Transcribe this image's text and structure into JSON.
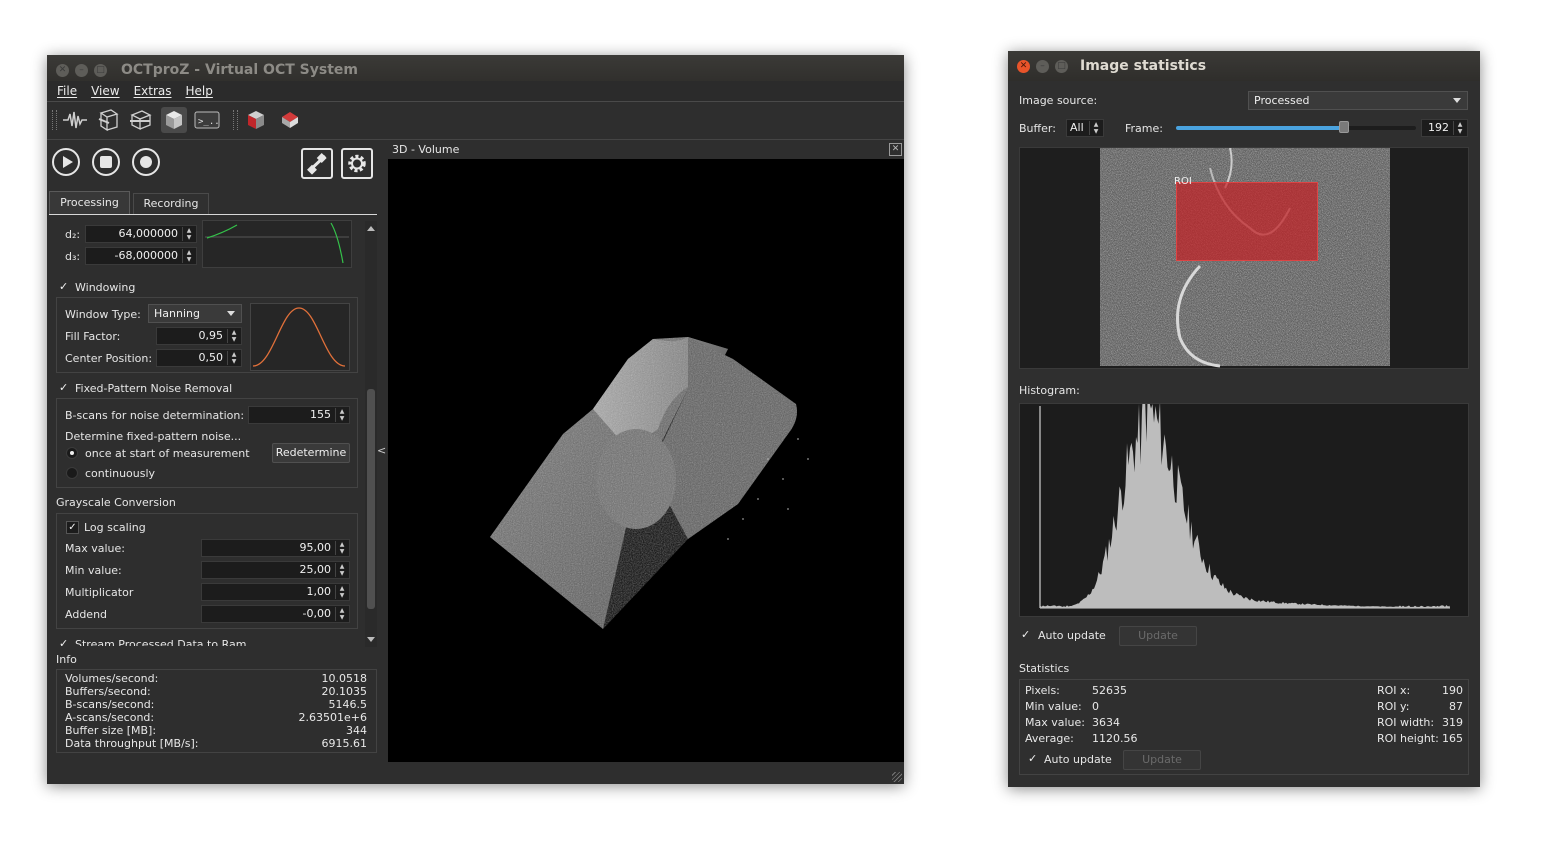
{
  "main_window": {
    "title": "OCTproZ - Virtual OCT System",
    "menu": [
      "File",
      "View",
      "Extras",
      "Help"
    ],
    "toolbar_icons": [
      "signal-plot-icon",
      "bscan-icon",
      "enface-icon",
      "volume-icon",
      "console-icon",
      "extension-icon",
      "extension-red-icon"
    ],
    "control_icons": [
      "play-icon",
      "stop-icon",
      "record-icon",
      "system-connect-icon",
      "settings-gear-icon"
    ],
    "tabs": [
      "Processing",
      "Recording"
    ],
    "dispersion": {
      "d2_label": "d₂:",
      "d2_value": "64,000000",
      "d3_label": "d₃:",
      "d3_value": "-68,000000"
    },
    "windowing": {
      "title": "Windowing",
      "window_type_label": "Window Type:",
      "window_type_value": "Hanning",
      "fill_factor_label": "Fill Factor:",
      "fill_factor_value": "0,95",
      "center_position_label": "Center Position:",
      "center_position_value": "0,50"
    },
    "fixed_pattern": {
      "title": "Fixed-Pattern Noise Removal",
      "bscans_label": "B-scans for noise determination:",
      "bscans_value": "155",
      "determine_label": "Determine fixed-pattern noise...",
      "option_once": "once at start of measurement",
      "option_continuous": "continuously",
      "redetermine_button": "Redetermine"
    },
    "grayscale": {
      "title": "Grayscale Conversion",
      "log_scaling_label": "Log scaling",
      "max_label": "Max value:",
      "max_value": "95,00",
      "min_label": "Min value:",
      "min_value": "25,00",
      "mult_label": "Multiplicator",
      "mult_value": "1,00",
      "addend_label": "Addend",
      "addend_value": "-0,00"
    },
    "stream_label": "Stream Processed Data to Ram",
    "info": {
      "title": "Info",
      "rows": [
        {
          "label": "Volumes/second:",
          "value": "10.0518"
        },
        {
          "label": "Buffers/second:",
          "value": "20.1035"
        },
        {
          "label": "B-scans/second:",
          "value": "5146.5"
        },
        {
          "label": "A-scans/second:",
          "value": "2.63501e+6"
        },
        {
          "label": "Buffer size [MB]:",
          "value": "344"
        },
        {
          "label": "Data throughput [MB/s]:",
          "value": "6915.61"
        }
      ]
    },
    "volume_view_title": "3D - Volume",
    "collapse_handle": "<"
  },
  "stats_window": {
    "title": "Image statistics",
    "image_source_label": "Image source:",
    "image_source_value": "Processed",
    "buffer_label": "Buffer:",
    "buffer_value": "All",
    "frame_label": "Frame:",
    "frame_value": "192",
    "frame_slider_fraction": 0.7,
    "roi_label": "ROI",
    "histogram_label": "Histogram:",
    "auto_update_label": "Auto update",
    "update_button": "Update",
    "statistics_title": "Statistics",
    "stats_left": [
      {
        "label": "Pixels:",
        "value": "52635"
      },
      {
        "label": "Min value:",
        "value": "0"
      },
      {
        "label": "Max value:",
        "value": "3634"
      },
      {
        "label": "Average:",
        "value": "1120.56"
      }
    ],
    "stats_right": [
      {
        "label": "ROI x:",
        "value": "190"
      },
      {
        "label": "ROI y:",
        "value": "87"
      },
      {
        "label": "ROI width:",
        "value": "319"
      },
      {
        "label": "ROI height:",
        "value": "165"
      }
    ]
  },
  "colors": {
    "window_bg": "#2e2e2e",
    "close_button": "#e9542a",
    "roi_red": "#c0262a",
    "slider_blue": "#4aa3df",
    "window_curve": "#e0703a",
    "dispersion_curve": "#34c24a"
  }
}
